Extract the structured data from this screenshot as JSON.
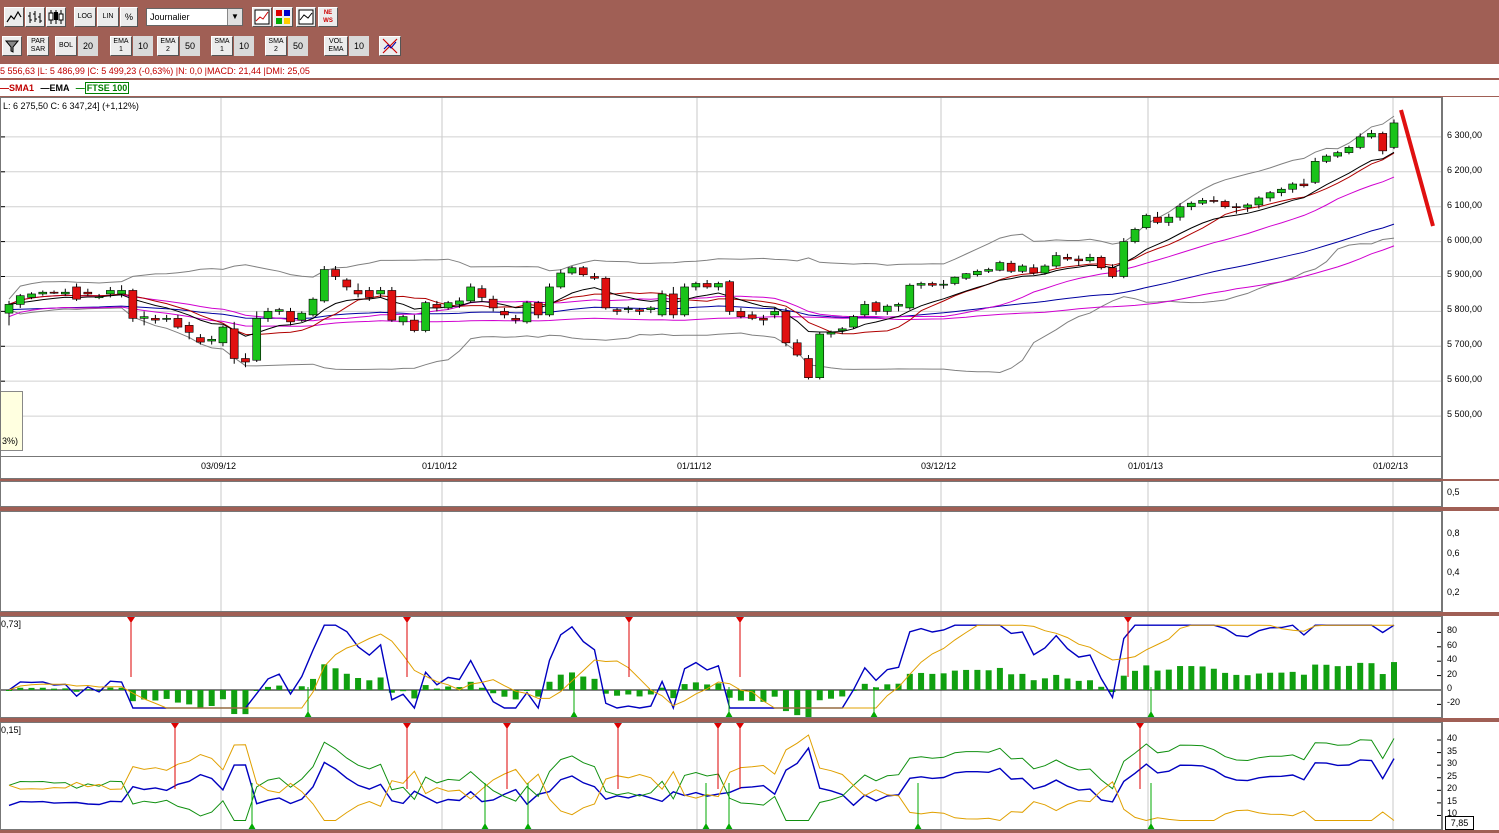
{
  "toolbar1": {
    "period_select": "Journalier",
    "log_label": "LOG",
    "lin_label": "LIN",
    "pct_label": "%",
    "news_label": "NE WS"
  },
  "toolbar2": {
    "parsar_label": "PAR SAR",
    "bol_label": "BOL",
    "bol_value": "20",
    "ema1_label": "EMA 1",
    "ema1_value": "10",
    "ema2_label": "EMA 2",
    "ema2_value": "50",
    "sma1_label": "SMA 1",
    "sma1_value": "10",
    "sma2_label": "SMA 2",
    "sma2_value": "50",
    "volema_label": "VOL EMA",
    "volema_value": "10"
  },
  "info_line": "5 556,63 |L: 5 486,99 |C: 5 499,23 (-0,63%) |N: 0,0 |MACD: 21,44 |DMI: 25,05",
  "legend": [
    {
      "label": "SMA1",
      "color": "#c00000"
    },
    {
      "label": "EMA",
      "color": "#000000"
    },
    {
      "label": "FTSE 100",
      "color": "#008000"
    }
  ],
  "ohlc_readout": "L: 6 275,50  C: 6 347,24] (+1,12%)",
  "tooltip_fragment": "3%)",
  "osc1_readout": "0,73]",
  "osc2_readout": "0,15]",
  "corner_value": "7,85",
  "colors": {
    "up": "#19c319",
    "down": "#e01010",
    "sma": "#b00000",
    "ema": "#000000",
    "bb": "#808080",
    "blue": "#0000a0",
    "magenta": "#d000d0",
    "orange": "#e0a000",
    "green": "#109010"
  },
  "chart_data": {
    "type": "candlestick",
    "x_labels": [
      "03/09/12",
      "01/10/12",
      "01/11/12",
      "03/12/12",
      "01/01/13",
      "01/02/13"
    ],
    "y_ticks": [
      "6 300,00",
      "6 200,00",
      "6 100,00",
      "6 000,00",
      "5 900,00",
      "5 800,00",
      "5 700,00",
      "5 600,00",
      "5 500,00"
    ],
    "ylim": [
      5420,
      6400
    ],
    "candles": [
      [
        5795,
        5830,
        5760,
        5820
      ],
      [
        5820,
        5850,
        5810,
        5845
      ],
      [
        5840,
        5855,
        5835,
        5850
      ],
      [
        5850,
        5860,
        5845,
        5855
      ],
      [
        5855,
        5860,
        5850,
        5852
      ],
      [
        5850,
        5865,
        5845,
        5855
      ],
      [
        5870,
        5880,
        5830,
        5835
      ],
      [
        5855,
        5865,
        5845,
        5850
      ],
      [
        5840,
        5850,
        5835,
        5842
      ],
      [
        5850,
        5870,
        5840,
        5860
      ],
      [
        5850,
        5875,
        5840,
        5860
      ],
      [
        5860,
        5865,
        5770,
        5780
      ],
      [
        5780,
        5800,
        5760,
        5785
      ],
      [
        5780,
        5790,
        5765,
        5775
      ],
      [
        5780,
        5790,
        5770,
        5780
      ],
      [
        5780,
        5790,
        5750,
        5755
      ],
      [
        5760,
        5770,
        5720,
        5740
      ],
      [
        5725,
        5735,
        5705,
        5712
      ],
      [
        5715,
        5730,
        5705,
        5720
      ],
      [
        5710,
        5760,
        5700,
        5755
      ],
      [
        5750,
        5770,
        5650,
        5665
      ],
      [
        5665,
        5680,
        5640,
        5655
      ],
      [
        5660,
        5800,
        5655,
        5780
      ],
      [
        5780,
        5810,
        5770,
        5800
      ],
      [
        5800,
        5810,
        5790,
        5805
      ],
      [
        5800,
        5810,
        5760,
        5770
      ],
      [
        5775,
        5800,
        5770,
        5795
      ],
      [
        5790,
        5840,
        5785,
        5835
      ],
      [
        5830,
        5930,
        5825,
        5920
      ],
      [
        5920,
        5930,
        5890,
        5900
      ],
      [
        5890,
        5895,
        5860,
        5870
      ],
      [
        5860,
        5880,
        5840,
        5850
      ],
      [
        5860,
        5870,
        5830,
        5840
      ],
      [
        5850,
        5870,
        5840,
        5860
      ],
      [
        5860,
        5870,
        5770,
        5775
      ],
      [
        5770,
        5790,
        5760,
        5785
      ],
      [
        5775,
        5790,
        5740,
        5745
      ],
      [
        5745,
        5830,
        5740,
        5825
      ],
      [
        5820,
        5830,
        5800,
        5810
      ],
      [
        5810,
        5830,
        5805,
        5825
      ],
      [
        5820,
        5840,
        5810,
        5830
      ],
      [
        5830,
        5880,
        5825,
        5870
      ],
      [
        5865,
        5875,
        5830,
        5840
      ],
      [
        5835,
        5845,
        5800,
        5810
      ],
      [
        5800,
        5810,
        5780,
        5790
      ],
      [
        5780,
        5790,
        5765,
        5775
      ],
      [
        5770,
        5830,
        5765,
        5825
      ],
      [
        5825,
        5830,
        5780,
        5790
      ],
      [
        5790,
        5880,
        5785,
        5870
      ],
      [
        5870,
        5920,
        5865,
        5910
      ],
      [
        5910,
        5930,
        5905,
        5925
      ],
      [
        5925,
        5930,
        5900,
        5905
      ],
      [
        5900,
        5910,
        5890,
        5895
      ],
      [
        5895,
        5900,
        5805,
        5810
      ],
      [
        5805,
        5810,
        5790,
        5800
      ],
      [
        5805,
        5815,
        5795,
        5808
      ],
      [
        5805,
        5810,
        5790,
        5800
      ],
      [
        5805,
        5815,
        5795,
        5810
      ],
      [
        5790,
        5860,
        5785,
        5850
      ],
      [
        5850,
        5870,
        5780,
        5790
      ],
      [
        5790,
        5880,
        5785,
        5870
      ],
      [
        5870,
        5885,
        5860,
        5880
      ],
      [
        5880,
        5890,
        5865,
        5870
      ],
      [
        5870,
        5885,
        5860,
        5880
      ],
      [
        5885,
        5890,
        5790,
        5800
      ],
      [
        5800,
        5810,
        5780,
        5785
      ],
      [
        5790,
        5800,
        5775,
        5780
      ],
      [
        5780,
        5790,
        5760,
        5775
      ],
      [
        5790,
        5810,
        5780,
        5800
      ],
      [
        5800,
        5810,
        5700,
        5710
      ],
      [
        5710,
        5720,
        5670,
        5675
      ],
      [
        5665,
        5675,
        5605,
        5610
      ],
      [
        5610,
        5740,
        5605,
        5735
      ],
      [
        5735,
        5745,
        5725,
        5740
      ],
      [
        5745,
        5755,
        5735,
        5750
      ],
      [
        5755,
        5790,
        5750,
        5785
      ],
      [
        5790,
        5830,
        5785,
        5820
      ],
      [
        5825,
        5830,
        5790,
        5800
      ],
      [
        5800,
        5820,
        5790,
        5815
      ],
      [
        5815,
        5825,
        5800,
        5820
      ],
      [
        5810,
        5880,
        5805,
        5875
      ],
      [
        5875,
        5885,
        5865,
        5880
      ],
      [
        5880,
        5885,
        5870,
        5875
      ],
      [
        5875,
        5890,
        5865,
        5878
      ],
      [
        5880,
        5900,
        5875,
        5898
      ],
      [
        5895,
        5910,
        5890,
        5908
      ],
      [
        5905,
        5920,
        5900,
        5915
      ],
      [
        5915,
        5925,
        5910,
        5920
      ],
      [
        5918,
        5945,
        5915,
        5940
      ],
      [
        5938,
        5945,
        5910,
        5915
      ],
      [
        5915,
        5935,
        5910,
        5930
      ],
      [
        5925,
        5935,
        5905,
        5910
      ],
      [
        5910,
        5935,
        5905,
        5930
      ],
      [
        5930,
        5970,
        5925,
        5960
      ],
      [
        5955,
        5965,
        5945,
        5950
      ],
      [
        5950,
        5960,
        5930,
        5945
      ],
      [
        5945,
        5965,
        5940,
        5955
      ],
      [
        5955,
        5960,
        5920,
        5925
      ],
      [
        5925,
        5935,
        5895,
        5900
      ],
      [
        5900,
        6010,
        5895,
        6000
      ],
      [
        6000,
        6040,
        5995,
        6035
      ],
      [
        6040,
        6080,
        6035,
        6075
      ],
      [
        6070,
        6085,
        6050,
        6055
      ],
      [
        6055,
        6080,
        6045,
        6070
      ],
      [
        6070,
        6110,
        6060,
        6100
      ],
      [
        6100,
        6115,
        6090,
        6110
      ],
      [
        6110,
        6125,
        6105,
        6118
      ],
      [
        6118,
        6130,
        6110,
        6115
      ],
      [
        6115,
        6120,
        6095,
        6100
      ],
      [
        6100,
        6110,
        6080,
        6098
      ],
      [
        6098,
        6110,
        6085,
        6105
      ],
      [
        6105,
        6130,
        6095,
        6125
      ],
      [
        6125,
        6145,
        6115,
        6140
      ],
      [
        6140,
        6155,
        6130,
        6150
      ],
      [
        6150,
        6170,
        6140,
        6165
      ],
      [
        6165,
        6180,
        6155,
        6160
      ],
      [
        6170,
        6240,
        6165,
        6230
      ],
      [
        6230,
        6250,
        6225,
        6245
      ],
      [
        6245,
        6260,
        6240,
        6255
      ],
      [
        6255,
        6275,
        6250,
        6270
      ],
      [
        6270,
        6310,
        6265,
        6300
      ],
      [
        6300,
        6320,
        6295,
        6310
      ],
      [
        6310,
        6315,
        6250,
        6260
      ],
      [
        6270,
        6350,
        6265,
        6340
      ]
    ],
    "osc1_ticks": [
      "80",
      "60",
      "40",
      "20",
      "0",
      "-20"
    ],
    "osc2_ticks": [
      "40",
      "35",
      "30",
      "25",
      "20",
      "15",
      "10"
    ],
    "upper_small_ticks": [
      "0,5"
    ],
    "mid_ticks": [
      "0,8",
      "0,6",
      "0,4",
      "0,2"
    ]
  }
}
